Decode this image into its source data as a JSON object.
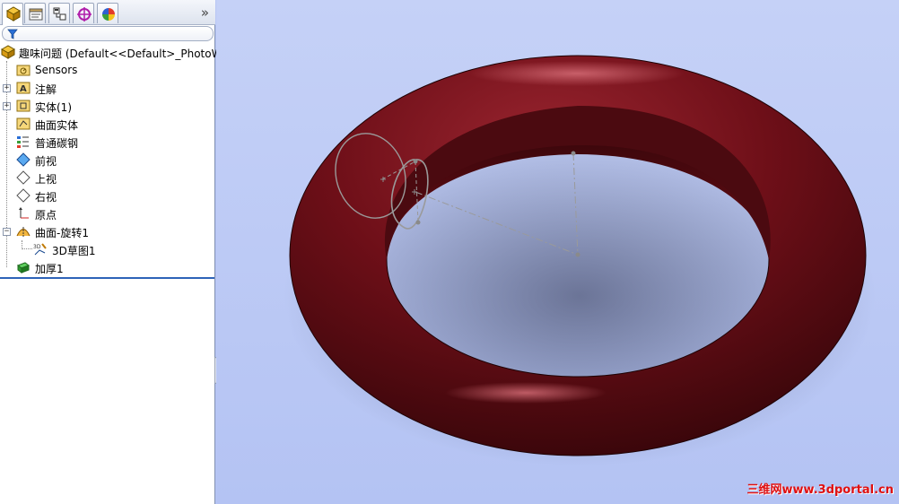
{
  "feature_manager": {
    "tabs": [
      {
        "icon": "feature-manager-tree-icon"
      },
      {
        "icon": "property-manager-icon"
      },
      {
        "icon": "configuration-manager-icon"
      },
      {
        "icon": "dimxpert-manager-icon"
      },
      {
        "icon": "display-manager-icon"
      }
    ],
    "more_label": "»",
    "filter_icon": "filter-icon",
    "root": {
      "label": "趣味问题  (Default<<Default>_PhotoW",
      "icon": "part-icon"
    },
    "items": [
      {
        "label": "Sensors",
        "icon": "sensors-folder-icon"
      },
      {
        "label": "注解",
        "icon": "annotations-icon",
        "expandable": true
      },
      {
        "label": "实体(1)",
        "icon": "solid-bodies-folder-icon",
        "expandable": true
      },
      {
        "label": "曲面实体",
        "icon": "surface-bodies-folder-icon"
      },
      {
        "label": "普通碳钢",
        "icon": "material-icon"
      },
      {
        "label": "前视",
        "icon": "plane-icon"
      },
      {
        "label": "上视",
        "icon": "plane-icon"
      },
      {
        "label": "右视",
        "icon": "plane-icon"
      },
      {
        "label": "原点",
        "icon": "origin-icon"
      },
      {
        "label": "曲面-旋转1",
        "icon": "surface-revolve-icon",
        "expandable": true,
        "expanded": true
      },
      {
        "label": "3D草图1",
        "icon": "3d-sketch-icon"
      },
      {
        "label": "加厚1",
        "icon": "thicken-icon"
      }
    ]
  },
  "viewport": {
    "model_color": "#6b0d14",
    "background_color": "#b8c6f4",
    "watermark": "三维网www.3dportal.cn"
  }
}
